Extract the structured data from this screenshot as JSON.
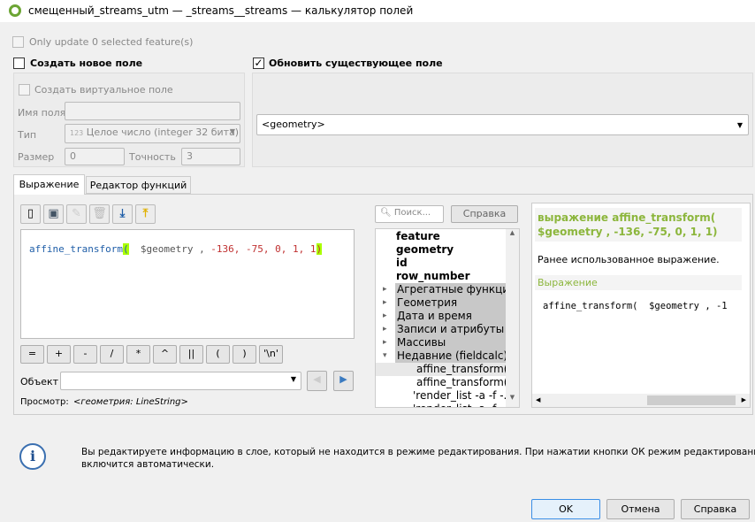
{
  "window": {
    "title": "смещенный_streams_utm — _streams__streams — калькулятор полей"
  },
  "only_update": {
    "label": "Only update 0 selected feature(s)",
    "checked": false
  },
  "create_new": {
    "label": "Создать новое поле",
    "checked": false,
    "virtual_label": "Создать виртуальное поле",
    "name_label": "Имя поля",
    "name_value": "",
    "type_label": "Тип",
    "type_icon": "123",
    "type_value": "Целое число (integer 32 бита)",
    "size_label": "Размер",
    "size_value": "0",
    "precision_label": "Точность",
    "precision_value": "3"
  },
  "update_existing": {
    "label": "Обновить существующее поле",
    "checked": true,
    "field_value": "<geometry>"
  },
  "tabs": [
    {
      "label": "Выражение",
      "active": true
    },
    {
      "label": "Редактор функций",
      "active": false
    }
  ],
  "toolbar": [
    "new-file-icon",
    "save-icon",
    "edit-icon",
    "delete-icon",
    "load-icon",
    "export-icon"
  ],
  "expression": {
    "func": "affine_transform",
    "open": "(",
    "arg": "  $geometry ,",
    "nums": " -136, -75, 0, 1, 1",
    "close": ")"
  },
  "operators": [
    "=",
    "+",
    "-",
    "/",
    "*",
    "^",
    "||",
    "(",
    ")",
    "'\\n'"
  ],
  "object": {
    "label": "Объект",
    "value": ""
  },
  "preview": {
    "label": "Просмотр:",
    "value": "<геометрия: LineString>"
  },
  "search": {
    "placeholder": "Поиск..."
  },
  "help_button": "Справка",
  "tree": [
    {
      "label": "feature",
      "bold": true,
      "level": 0
    },
    {
      "label": "geometry",
      "bold": true,
      "level": 0
    },
    {
      "label": "id",
      "bold": true,
      "level": 0
    },
    {
      "label": "row_number",
      "bold": true,
      "level": 0
    },
    {
      "label": "Агрегатные функции",
      "group": true,
      "level": 0
    },
    {
      "label": "Геометрия",
      "group": true,
      "level": 0
    },
    {
      "label": "Дата и время",
      "group": true,
      "level": 0
    },
    {
      "label": "Записи и атрибуты",
      "group": true,
      "level": 0
    },
    {
      "label": "Массивы",
      "group": true,
      "level": 0
    },
    {
      "label": "Недавние (fieldcalc)",
      "group": true,
      "expanded": true,
      "level": 0
    },
    {
      "label": "affine_transform(...",
      "level": 2,
      "selected": true
    },
    {
      "label": "affine_transform(...",
      "level": 2
    },
    {
      "label": "'render_list -a -f -...",
      "level": 1
    },
    {
      "label": "'render_list -a -f -...",
      "level": 1
    }
  ],
  "help_panel": {
    "title": "выражение affine_transform( $geometry , -136, -75, 0, 1, 1)",
    "description": "Ранее использованное выражение.",
    "section": "Выражение",
    "code": "affine_transform(  $geometry , -1"
  },
  "info": {
    "text1": "Вы редактируете информацию в слое, который не находится в режиме редактирования. При нажатии кнопки ОК режим редактирования",
    "text2": "включится автоматически."
  },
  "buttons": {
    "ok": "OK",
    "cancel": "Отмена",
    "help": "Справка"
  },
  "colors": {
    "accent": "#8cb63c",
    "func": "#1f5ea8",
    "number": "#c03030",
    "bracket_highlight": "#aaff00"
  }
}
